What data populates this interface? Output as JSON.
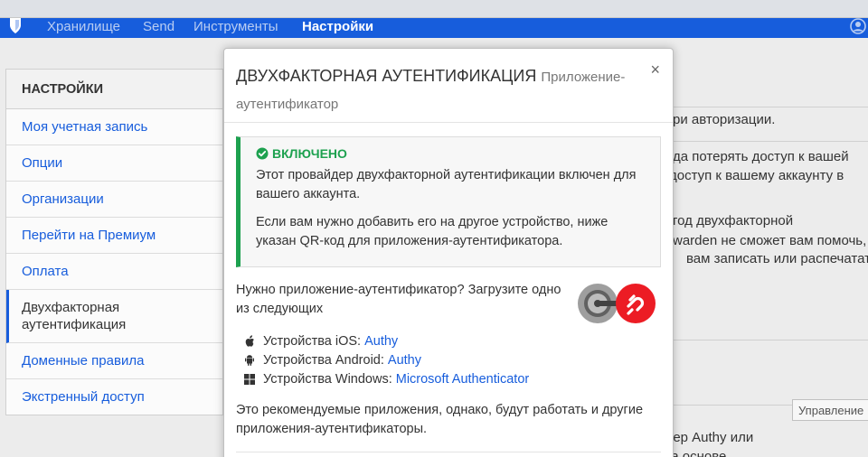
{
  "navbar": {
    "items": [
      "Хранилище",
      "Send",
      "Инструменты",
      "Настройки"
    ]
  },
  "sidebar": {
    "header": "НАСТРОЙКИ",
    "items": [
      "Моя учетная запись",
      "Опции",
      "Организации",
      "Перейти на Премиум",
      "Оплата",
      "Двухфакторная аутентификация",
      "Доменные правила",
      "Экстренный доступ"
    ]
  },
  "background": {
    "line1": "ри авторизации.",
    "line2": "да потерять доступ к вашей",
    "line3": " доступ к вашему аккаунту в",
    "line4": "год двухфакторной",
    "line5": "warden не сможет вам помочь,",
    "line6": " вам записать или распечатать",
    "line7": "мер Authy или",
    "line8": "на основе",
    "manage_button": "Управление"
  },
  "modal": {
    "title": "ДВУХФАКТОРНАЯ АУТЕНТИФИКАЦИЯ",
    "subtitle": "Приложение-аутентификатор",
    "close": "×",
    "callout": {
      "title": "ВКЛЮЧЕНО",
      "p1": "Этот провайдер двухфакторной аутентификации включен для вашего аккаунта.",
      "p2": "Если вам нужно добавить его на другое устройство, ниже указан QR-код для приложения-аутентификатора."
    },
    "need_app": "Нужно приложение-аутентификатор? Загрузите одно из следующих",
    "devices": [
      {
        "label": "Устройства iOS:",
        "link": "Authy",
        "icon": "apple-icon"
      },
      {
        "label": "Устройства Android:",
        "link": "Authy",
        "icon": "android-icon"
      },
      {
        "label": "Устройства Windows:",
        "link": "Microsoft Authenticator",
        "icon": "windows-icon"
      }
    ],
    "recommendation": "Это рекомендуемые приложения, однако, будут работать и другие приложения-аутентификаторы."
  },
  "colors": {
    "brand": "#175ddc",
    "success": "#1da14f",
    "authy": "#ec1c24"
  }
}
